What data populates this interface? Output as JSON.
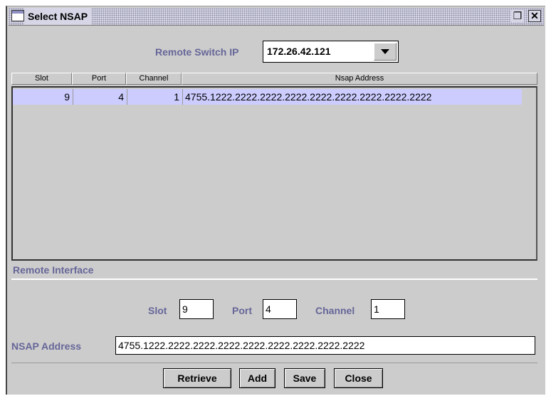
{
  "window": {
    "title": "Select NSAP"
  },
  "remote_switch": {
    "label": "Remote Switch IP",
    "value": "172.26.42.121"
  },
  "table": {
    "columns": [
      "Slot",
      "Port",
      "Channel",
      "Nsap Address"
    ],
    "rows": [
      {
        "slot": "9",
        "port": "4",
        "channel": "1",
        "nsap": "4755.1222.2222.2222.2222.2222.2222.2222.2222.2222"
      }
    ]
  },
  "remote_interface": {
    "section_label": "Remote Interface",
    "slot_label": "Slot",
    "slot_value": "9",
    "port_label": "Port",
    "port_value": "4",
    "channel_label": "Channel",
    "channel_value": "1",
    "nsap_label": "NSAP Address",
    "nsap_value": "4755.1222.2222.2222.2222.2222.2222.2222.2222.2222"
  },
  "buttons": {
    "retrieve": "Retrieve",
    "add": "Add",
    "save": "Save",
    "close": "Close"
  },
  "icons": [
    "window-icon",
    "restore-icon",
    "close-icon",
    "dropdown-arrow-icon"
  ]
}
